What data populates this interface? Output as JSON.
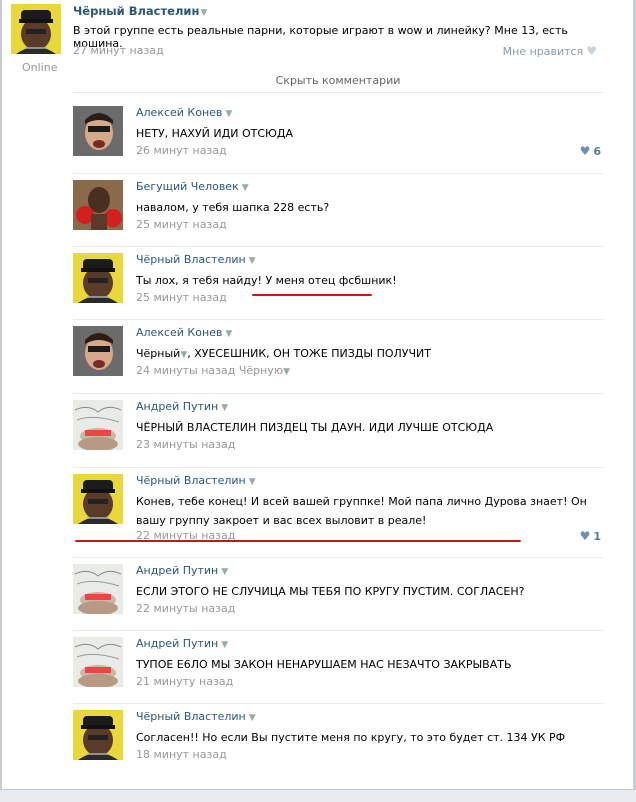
{
  "post": {
    "author": "Чёрный Властелин",
    "text": "В этой группе есть реальные парни, которые играют в wow и линейку? Мне 13, есть мошина.",
    "time": "27 минут назад",
    "status": "Online",
    "like_label": "Мне нравится"
  },
  "hide_comments": "Скрыть комментарии",
  "comments": [
    {
      "author": "Алексей Конев",
      "text": "НЕТУ, НАХУЙ ИДИ ОТСЮДА",
      "time": "26 минут назад",
      "likes": "6",
      "avatar": "konev"
    },
    {
      "author": "Бегущий Человек",
      "text": "навалом, у тебя шапка 228 есть?",
      "time": "25 минут назад",
      "likes": "",
      "avatar": "runner"
    },
    {
      "author": "Чёрный Властелин",
      "text": "Ты лох, я тебя найду! У меня отец фсбшник!",
      "time": "25 минут назад",
      "likes": "",
      "avatar": "vlastelin"
    },
    {
      "author": "Алексей Конев",
      "text_mention": "Чёрный",
      "text_rest": ", ХУЕСЕШНИК, ОН ТОЖЕ ПИЗДЫ ПОЛУЧИТ",
      "time": "24 минуты назад",
      "reply_to": "Чёрную",
      "likes": "",
      "avatar": "konev"
    },
    {
      "author": "Андрей Путин",
      "text": "ЧЁРНЫЙ ВЛАСТЕЛИН ПИЗДЕЦ ТЫ ДАУН. ИДИ ЛУЧШЕ ОТСЮДА",
      "time": "23 минуты назад",
      "likes": "",
      "avatar": "putin"
    },
    {
      "author": "Чёрный Властелин",
      "text": "Конев, тебе конец! И всей вашей группке! Мой папа лично Дурова знает! Он вашу группу закроет и вас всех выловит в реале!",
      "time": "22 минуты назад",
      "likes": "1",
      "avatar": "vlastelin"
    },
    {
      "author": "Андрей Путин",
      "text": "ЕСЛИ ЭТОГО НЕ СЛУЧИЦА МЫ ТЕБЯ ПО КРУГУ ПУСТИМ. СОГЛАСЕН?",
      "time": "22 минуты назад",
      "likes": "",
      "avatar": "putin"
    },
    {
      "author": "Андрей Путин",
      "text": "ТУПОЕ Е6ЛО МЫ ЗАКОН НЕНАРУШАЕМ НАС НЕЗАЧТО ЗАКРЫВАТЬ",
      "time": "21 минуту назад",
      "likes": "",
      "avatar": "putin"
    },
    {
      "author": "Чёрный Властелин",
      "text": "Согласен!! Но если Вы пустите меня по кругу, то это будет ст. 134 УК РФ",
      "time": "18 минут назад",
      "likes": "",
      "avatar": "vlastelin"
    }
  ],
  "colors": {
    "link": "#2b587a",
    "meta": "#999999",
    "annotation_red": "#c21a1a"
  }
}
